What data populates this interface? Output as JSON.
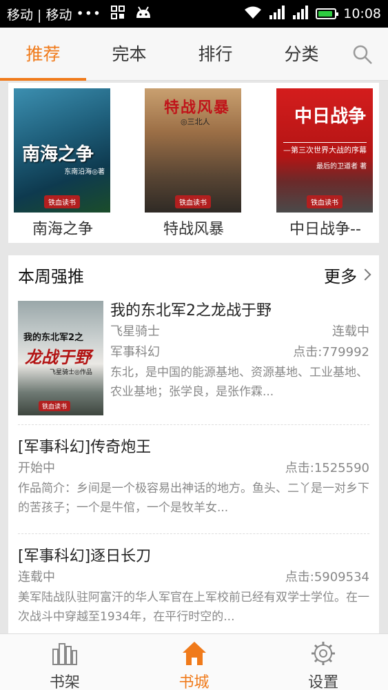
{
  "statusbar": {
    "carrier": "移动 | 移动",
    "dots": "•••",
    "time": "10:08",
    "battery_level": 0.9
  },
  "tabs": [
    {
      "label": "推荐",
      "active": true
    },
    {
      "label": "完本",
      "active": false
    },
    {
      "label": "排行",
      "active": false
    },
    {
      "label": "分类",
      "active": false
    }
  ],
  "featured": [
    {
      "name": "南海之争",
      "cover_title": "南海之争",
      "cover_author": "东南沿海◎著",
      "logo": "铁血读书"
    },
    {
      "name": "特战风暴",
      "cover_title": "特战风暴",
      "cover_author": "◎三北人",
      "logo": "铁血读书"
    },
    {
      "name": "中日战争--",
      "cover_title": "中日战争",
      "cover_sub": "—第三次世界大战的序幕",
      "cover_author": "最后的卫道者 著",
      "logo": "铁血读书"
    }
  ],
  "weekly": {
    "title": "本周强推",
    "more": "更多",
    "books": [
      {
        "title": "我的东北军2之龙战于野",
        "author": "飞星骑士",
        "status": "连载中",
        "category": "军事科幻",
        "clicks": "点击:779992",
        "desc": "东北，是中国的能源基地、资源基地、工业基地、农业基地；张学良，是张作霖...",
        "cover_line1": "我的东北军2之",
        "cover_line2": "龙战于野",
        "cover_line3": "飞星骑士◎作品",
        "logo": "铁血读书"
      },
      {
        "title": "[军事科幻]传奇炮王",
        "status": "开始中",
        "clicks": "点击:1525590",
        "desc": "作品简介：乡间是一个极容易出神话的地方。鱼头、二丫是一对乡下的苦孩子；一个是牛倌，一个是牧羊女..."
      },
      {
        "title": "[军事科幻]逐日长刀",
        "status": "连载中",
        "clicks": "点击:5909534",
        "desc": "美军陆战队驻阿富汗的华人军官在上军校前已经有双学士学位。在一次战斗中穿越至1934年，在平行时空的..."
      }
    ]
  },
  "bottomnav": [
    {
      "label": "书架",
      "icon": "bookshelf-icon",
      "active": false
    },
    {
      "label": "书城",
      "icon": "home-icon",
      "active": true
    },
    {
      "label": "设置",
      "icon": "gear-icon",
      "active": false
    }
  ],
  "colors": {
    "accent": "#f07a1a",
    "muted_text": "#888888"
  }
}
